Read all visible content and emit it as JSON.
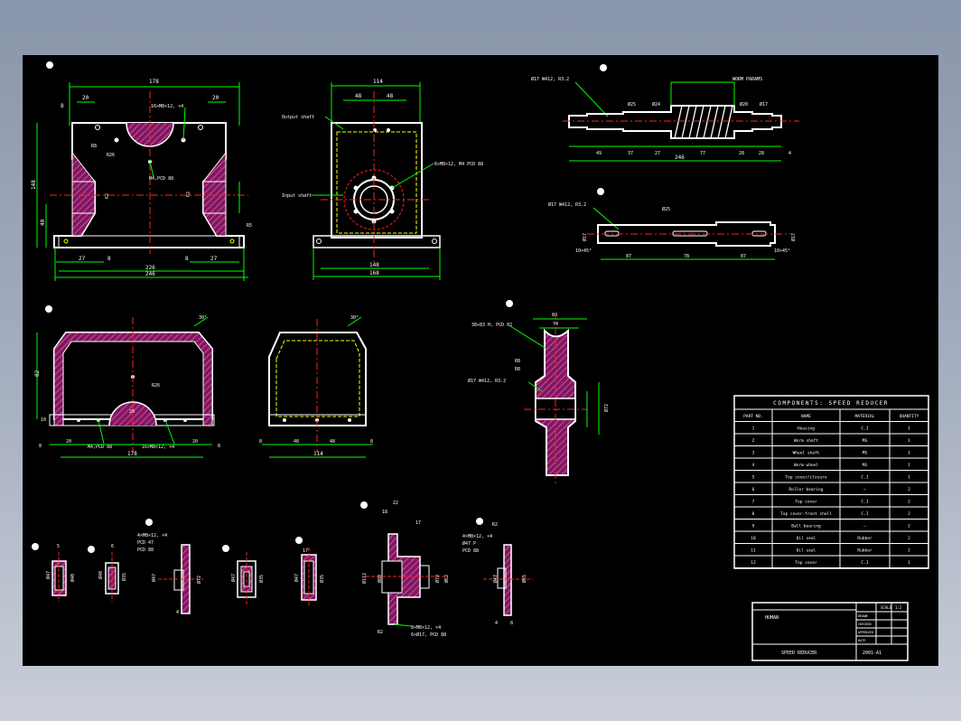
{
  "colors": {
    "background_outer": "#9aa3b5",
    "canvas": "#000000",
    "outline": "#ffffff",
    "dimension": "#00ff00",
    "centerline": "#ff2020",
    "hatch": "#c0248c",
    "hidden": "#ffff00"
  },
  "view_markers": [
    "1",
    "2",
    "3",
    "4",
    "5",
    "6",
    "7",
    "8",
    "9",
    "10",
    "11",
    "12",
    "13"
  ],
  "housing_front": {
    "top_overall": "178",
    "top_left": "20",
    "top_right": "20",
    "left_small": "8",
    "label_holes": "16×M8×12, ×4",
    "r8": "R8",
    "r26": "R26",
    "label_bolt": "M4,PCD 88",
    "bottom_overall": "226",
    "bottom_total": "246",
    "bottom_left": "27",
    "bottom_right": "27",
    "bottom_b1": "8",
    "bottom_b2": "8",
    "left_height": "148",
    "left_h2": "40",
    "left_h3": "10",
    "inner_dim": "62",
    "r5": "R5"
  },
  "housing_side": {
    "top_overall": "114",
    "top_left": "48",
    "top_right": "48",
    "label_output": "Output shaft",
    "label_input": "Input shaft",
    "label_holes": "6×M8×12, M4 PCD 88",
    "bottom_inner": "148",
    "bottom_total": "168"
  },
  "worm_shaft": {
    "label_left": "Ø17 W412, R3.2",
    "label_right": "WORM PARAMS",
    "d1": "Ø25",
    "d2": "Ø24",
    "d3": "Ø20",
    "d4": "Ø17",
    "segs": [
      "49",
      "37",
      "27",
      "77",
      "28",
      "28",
      "4"
    ],
    "total": "246"
  },
  "wheel_shaft": {
    "label_left": "Ø17 W412, R3.2",
    "d1": "Ø25",
    "d2": "Ø17",
    "left_note": "10×45°",
    "right_note": "10×45°",
    "segs": [
      "87",
      "78",
      "87"
    ]
  },
  "cover_front": {
    "angle": "30°",
    "r26": "R26",
    "dim_20": "20",
    "bottom_total": "178",
    "bottom_left": "20",
    "bottom_right": "20",
    "bottom_b1": "8",
    "bottom_b2": "8",
    "label_bolt": "M4,PCD 88",
    "label_holes": "16×M8×12, ×4",
    "left_height": "82",
    "left_h2": "10"
  },
  "cover_side": {
    "angle": "30°",
    "dims": [
      "8",
      "48",
      "48",
      "8"
    ],
    "total": "114"
  },
  "worm_wheel": {
    "top": "88",
    "top2": "74",
    "label1": "38×83 H, PCD 82",
    "label2": "R8",
    "label3": "R8",
    "label4": "Ø17 W412, R3.2",
    "right": "Ø72",
    "right2": "Ø58"
  },
  "table": {
    "title": "COMPONENTS: SPEED REDUCER",
    "headers": [
      "PART NO.",
      "NAME",
      "MATERIAL",
      "QUANTITY"
    ],
    "rows": [
      [
        "1",
        "Housing",
        "C.I",
        "1"
      ],
      [
        "2",
        "Worm shaft",
        "MS",
        "1"
      ],
      [
        "3",
        "Wheel shaft",
        "MS",
        "1"
      ],
      [
        "4",
        "Worm wheel",
        "MS",
        "1"
      ],
      [
        "5",
        "Top cover/closure",
        "C.I",
        "1"
      ],
      [
        "6",
        "Roller bearing",
        "—",
        "2"
      ],
      [
        "7",
        "Top cover",
        "C.I",
        "2"
      ],
      [
        "8",
        "Top cover-front shell",
        "C.I",
        "2"
      ],
      [
        "9",
        "Ball bearing",
        "—",
        "2"
      ],
      [
        "10",
        "Oil seal",
        "Rubber",
        "2"
      ],
      [
        "11",
        "Oil seal",
        "Rubber",
        "2"
      ],
      [
        "12",
        "Top cover",
        "C.I",
        "1"
      ]
    ]
  },
  "small_parts": {
    "p1": [
      "Ø47",
      "Ø40",
      "5",
      "8"
    ],
    "p2": [
      "Ø40",
      "Ø35",
      "6",
      "8"
    ],
    "p3": [
      "4×M8×12, ×4",
      "PCD 47",
      "PCD 88",
      "Ø47",
      "Ø72",
      "4",
      "8"
    ],
    "p4": [
      "Ø47",
      "Ø35",
      "8",
      "6"
    ],
    "p5": [
      "Ø47",
      "Ø35",
      "17",
      "8"
    ],
    "p6": [
      "22",
      "18",
      "17",
      "Ø112",
      "Ø88",
      "Ø72",
      "Ø62",
      "Ø40",
      "8×M8×12, ×4",
      "6×Ø17, PCD 88",
      "R2"
    ],
    "p7": [
      "4×M8×12, ×4",
      "Ø47 P",
      "PCD 88",
      "R2",
      "Ø47",
      "Ø65",
      "4",
      "8"
    ]
  },
  "title_block": {
    "name": "HUMAN",
    "drawing": "SPEED REDUCER",
    "number": "2001-A1",
    "cols": [
      "SCALE",
      "1:2"
    ],
    "rows": [
      "DRAWN",
      "CHECKED",
      "APPROVED",
      "DATE"
    ]
  }
}
